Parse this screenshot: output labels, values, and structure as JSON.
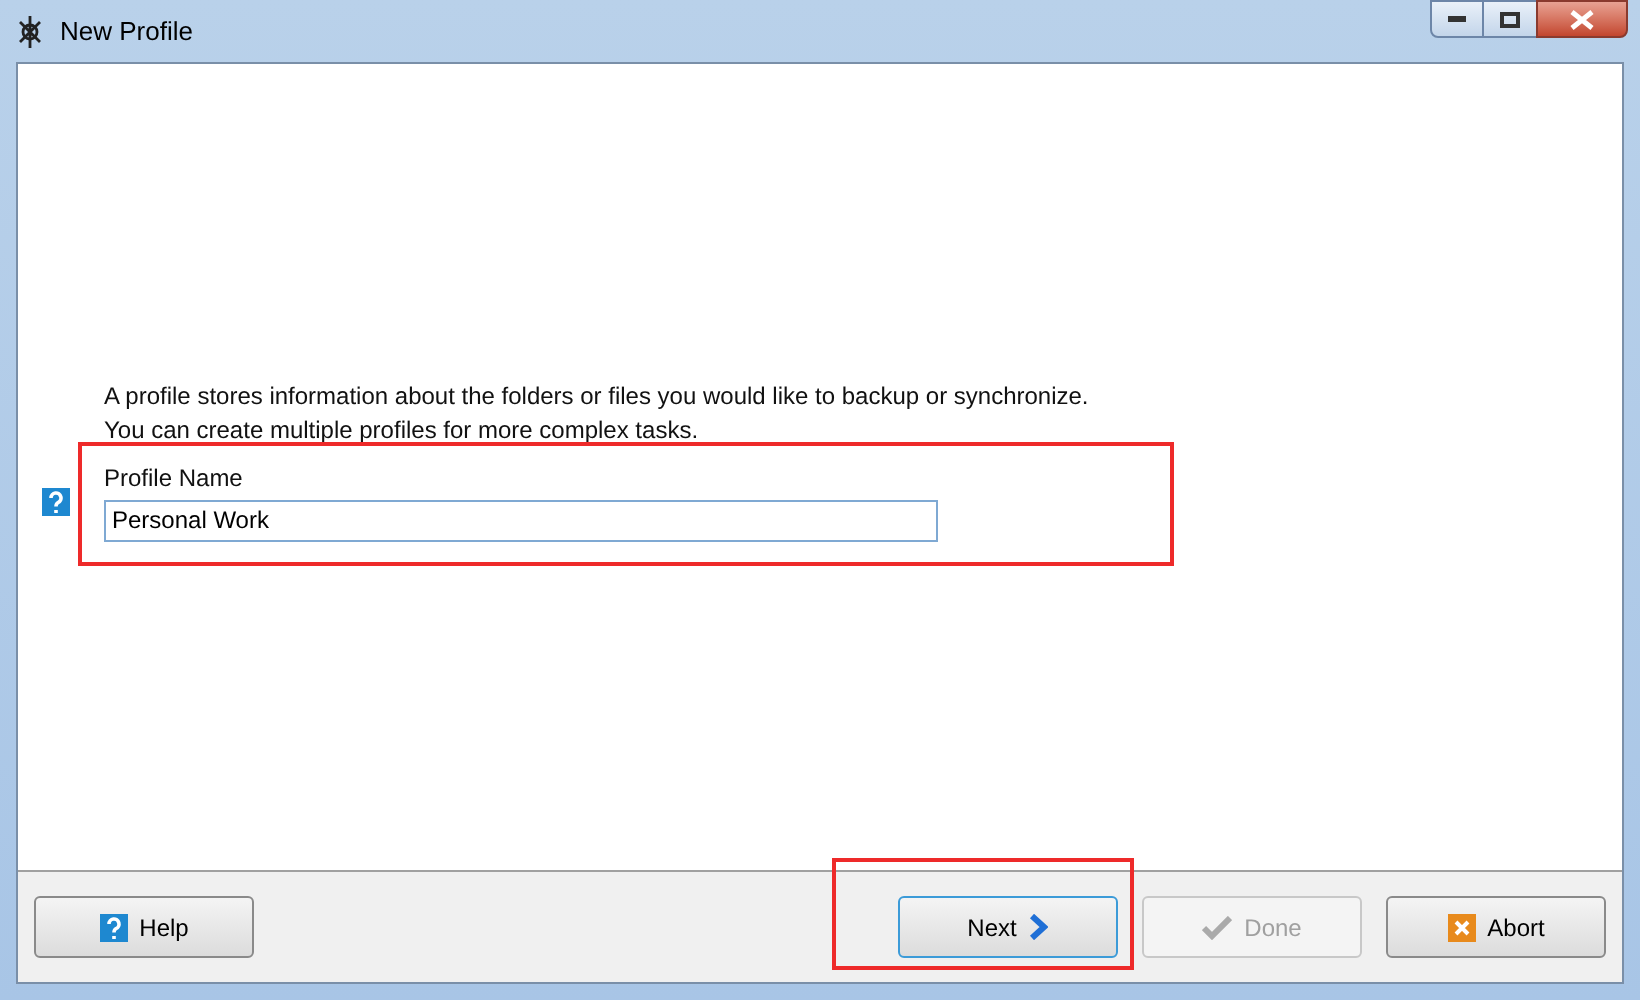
{
  "window": {
    "title": "New Profile"
  },
  "description": [
    "A profile stores information about the folders or files you would like to backup or synchronize.",
    "You can create multiple profiles for more complex tasks."
  ],
  "profile_name": {
    "label": "Profile Name",
    "value": "Personal Work"
  },
  "buttons": [
    {
      "kind": "help",
      "label": "Help",
      "disabled": false,
      "focused": false
    },
    {
      "kind": "next",
      "label": "Next",
      "disabled": false,
      "focused": true
    },
    {
      "kind": "done",
      "label": "Done",
      "disabled": true,
      "focused": false
    },
    {
      "kind": "abort",
      "label": "Abort",
      "disabled": false,
      "focused": false
    }
  ]
}
